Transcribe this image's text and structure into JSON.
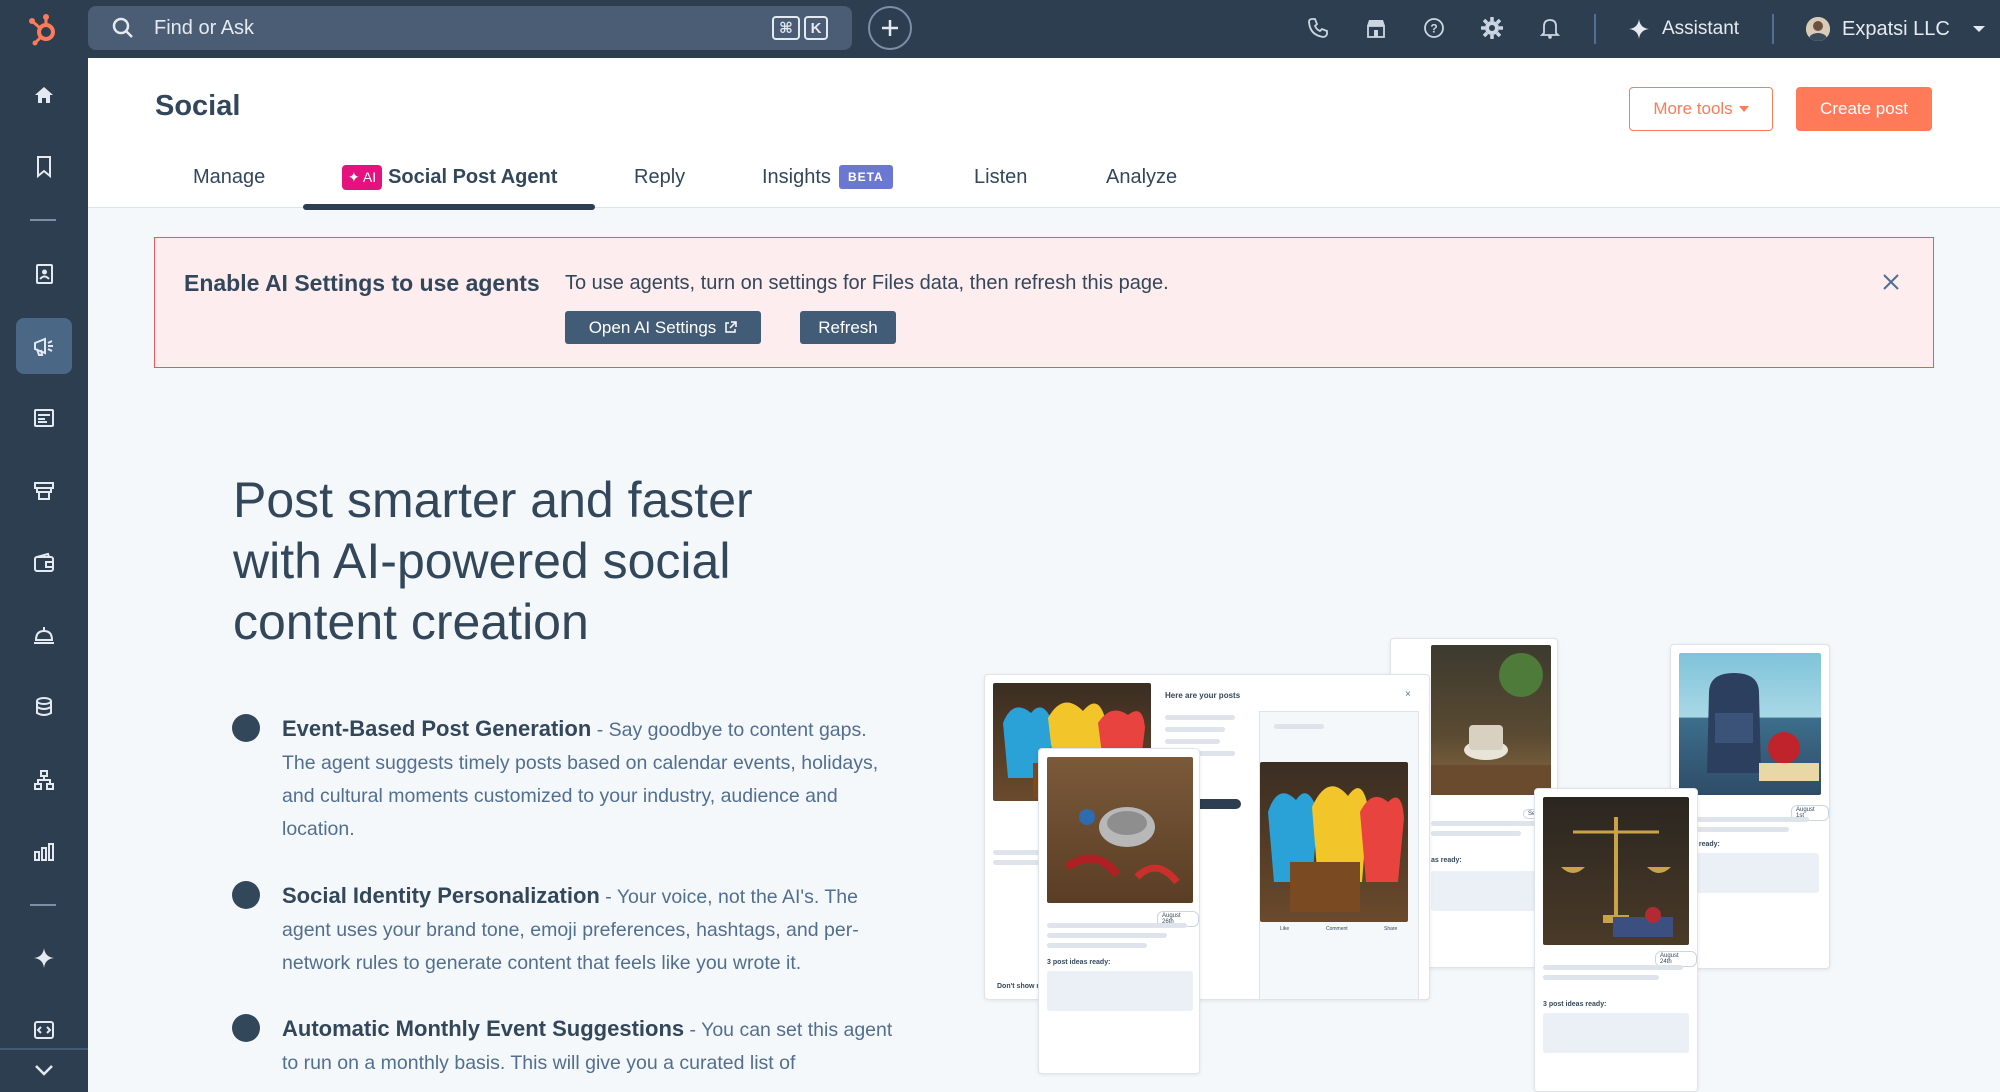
{
  "topbar": {
    "search_placeholder": "Find or Ask",
    "kbd_cmd": "⌘",
    "kbd_k": "K",
    "assistant_label": "Assistant",
    "account_name": "Expatsi LLC"
  },
  "header": {
    "title": "Social",
    "more_tools": "More tools",
    "create_post": "Create post",
    "tabs": [
      {
        "label": "Manage"
      },
      {
        "label": "Social Post Agent",
        "badge": "AI"
      },
      {
        "label": "Reply"
      },
      {
        "label": "Insights",
        "badge": "BETA"
      },
      {
        "label": "Listen"
      },
      {
        "label": "Analyze"
      }
    ]
  },
  "alert": {
    "title": "Enable AI Settings to use agents",
    "message": "To use agents, turn on settings for Files data, then refresh this page.",
    "open_settings": "Open AI Settings",
    "refresh": "Refresh"
  },
  "main": {
    "hero": "Post smarter and faster with AI-powered social content creation",
    "features": [
      {
        "title": "Event-Based Post Generation",
        "body": " - Say goodbye to content gaps. The agent suggests timely posts based on calendar events, holidays, and cultural moments customized to your industry, audience and location."
      },
      {
        "title": "Social Identity Personalization",
        "body": " - Your voice, not the AI's. The agent uses your brand tone, emoji preferences, hashtags, and per-network rules to generate content that feels like you wrote it."
      },
      {
        "title": "Automatic Monthly Event Suggestions",
        "body": " - You can set this agent to run on a monthly basis. This will give you a curated list of"
      }
    ]
  },
  "preview": {
    "panel_title": "Here are your posts",
    "ideas_1": "3 post ideas ready:",
    "ideas_2": "3 post ideas ready:",
    "ideas_3": "ideas ready:",
    "ideas_4": "as ready:",
    "date_1": "August 26th",
    "date_2": "August 24th",
    "date_3": "August 1st",
    "date_4": "Septembe",
    "dont_show": "Don't show me",
    "edit_post": "dit and post",
    "like": "Like",
    "comment": "Comment",
    "share": "Share"
  },
  "colors": {
    "topbar_bg": "#2d3e50",
    "accent": "#ff7a59",
    "alert_bg": "#fdedee",
    "alert_border": "#f2545b",
    "ai_badge": "#e4117f",
    "beta_badge": "#6a78d1"
  }
}
